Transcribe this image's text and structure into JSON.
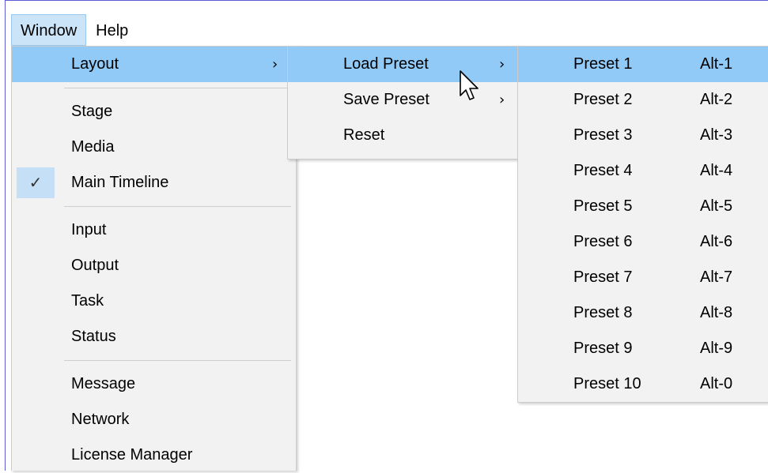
{
  "menubar": {
    "items": [
      "Window",
      "Help"
    ]
  },
  "window_menu": {
    "groups": [
      [
        {
          "label": "Layout",
          "submenu": true,
          "highlighted": true
        }
      ],
      [
        {
          "label": "Stage"
        },
        {
          "label": "Media"
        },
        {
          "label": "Main Timeline",
          "checked": true
        }
      ],
      [
        {
          "label": "Input"
        },
        {
          "label": "Output"
        },
        {
          "label": "Task"
        },
        {
          "label": "Status"
        }
      ],
      [
        {
          "label": "Message"
        },
        {
          "label": "Network"
        },
        {
          "label": "License Manager"
        }
      ]
    ]
  },
  "layout_menu": {
    "items": [
      {
        "label": "Load Preset",
        "submenu": true,
        "highlighted": true
      },
      {
        "label": "Save Preset",
        "submenu": true
      },
      {
        "label": "Reset"
      }
    ]
  },
  "preset_menu": {
    "items": [
      {
        "label": "Preset 1",
        "shortcut": "Alt-1",
        "highlighted": true
      },
      {
        "label": "Preset 2",
        "shortcut": "Alt-2"
      },
      {
        "label": "Preset 3",
        "shortcut": "Alt-3"
      },
      {
        "label": "Preset 4",
        "shortcut": "Alt-4"
      },
      {
        "label": "Preset 5",
        "shortcut": "Alt-5"
      },
      {
        "label": "Preset 6",
        "shortcut": "Alt-6"
      },
      {
        "label": "Preset 7",
        "shortcut": "Alt-7"
      },
      {
        "label": "Preset 8",
        "shortcut": "Alt-8"
      },
      {
        "label": "Preset 9",
        "shortcut": "Alt-9"
      },
      {
        "label": "Preset 10",
        "shortcut": "Alt-0"
      }
    ]
  },
  "icons": {
    "submenu_arrow": "chevron-right-icon",
    "check": "check-icon",
    "cursor": "mouse-pointer-icon"
  },
  "colors": {
    "highlight": "#91c9f7",
    "menu_bg": "#f2f2f2",
    "menubar_active": "#cce4f7"
  }
}
